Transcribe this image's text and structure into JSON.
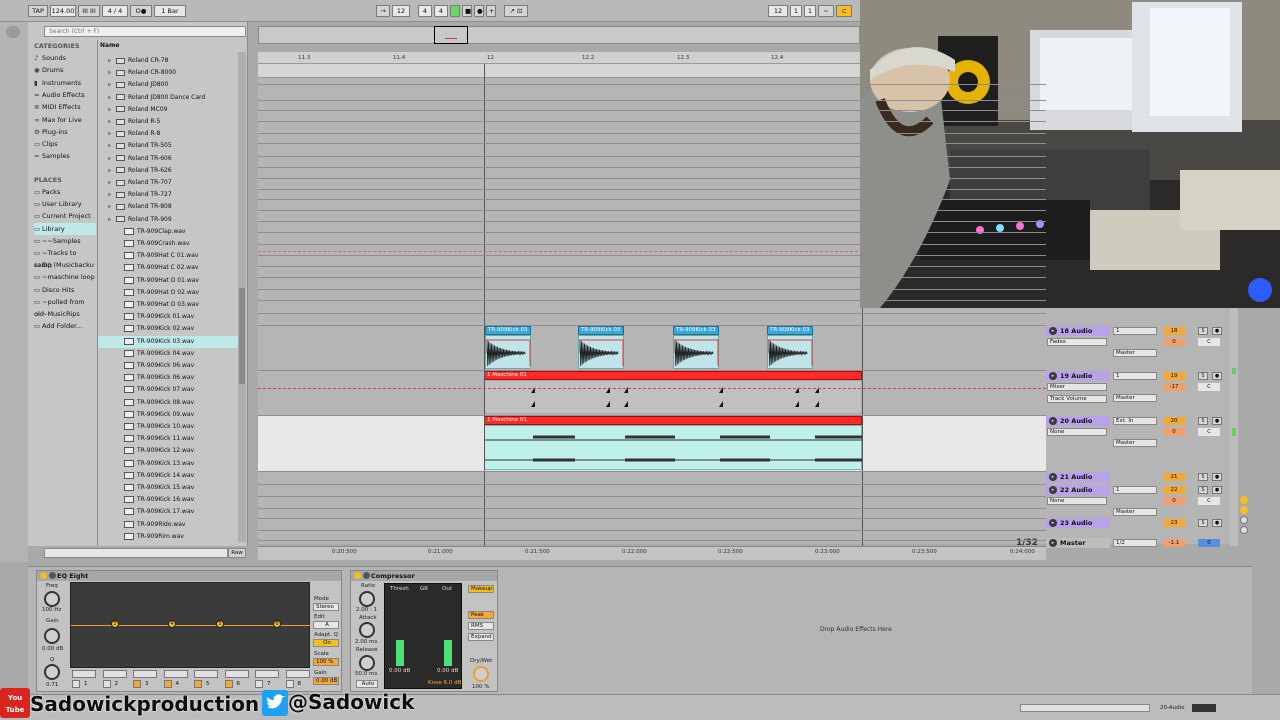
{
  "topbar": {
    "tap": "TAP",
    "tempo": "124.00",
    "sig": "4 / 4",
    "quant": "1 Bar",
    "pos_bar": "12",
    "pos_beat": "4",
    "pos_six": "4",
    "loop_bar": "12",
    "loop_beat": "1",
    "loop_six": "1"
  },
  "browser": {
    "search_placeholder": "Search (Ctrl + F)",
    "categories_title": "CATEGORIES",
    "categories": [
      "Sounds",
      "Drums",
      "Instruments",
      "Audio Effects",
      "MIDI Effects",
      "Max for Live",
      "Plug-ins",
      "Clips",
      "Samples"
    ],
    "places_title": "PLACES",
    "places": [
      "Packs",
      "User Library",
      "Current Project",
      "Library",
      "~~Samples",
      "~Tracks to samp",
      "D:\\ (Musicbacku",
      "~maschine loop",
      "Disco Hits",
      "~pulled from old",
      "~MusicRips",
      "Add Folder..."
    ],
    "name_header": "Name",
    "folders": [
      "Roland CR-78",
      "Roland CR-8000",
      "Roland JD800",
      "Roland JD800 Dance Card",
      "Roland MC09",
      "Roland R-5",
      "Roland R-8",
      "Roland TR-505",
      "Roland TR-606",
      "Roland TR-626",
      "Roland TR-707",
      "Roland TR-727",
      "Roland TR-808",
      "Roland TR-909"
    ],
    "files": [
      "TR-909Clap.wav",
      "TR-909Crash.wav",
      "TR-909Hat C 01.wav",
      "TR-909Hat C 02.wav",
      "TR-909Hat O 01.wav",
      "TR-909Hat O 02.wav",
      "TR-909Hat O 03.wav",
      "TR-909Kick 01.wav",
      "TR-909Kick 02.wav",
      "TR-909Kick 03.wav",
      "TR-909Kick 04.wav",
      "TR-909Kick 06.wav",
      "TR-909Kick 06.wav",
      "TR-909Kick 07.wav",
      "TR-909Kick 08.wav",
      "TR-909Kick 09.wav",
      "TR-909Kick 10.wav",
      "TR-909Kick 11.wav",
      "TR-909Kick 12.wav",
      "TR-909Kick 13.wav",
      "TR-909Kick 14.wav",
      "TR-909Kick 15.wav",
      "TR-909Kick 16.wav",
      "TR-909Kick 17.wav",
      "TR-909Rido.wav",
      "TR-909Rim.wav"
    ],
    "raw_label": "Raw"
  },
  "ruler": {
    "bars": [
      "11.3",
      "11.4",
      "12",
      "12.2",
      "12.3",
      "12.4"
    ]
  },
  "clips": {
    "kick": [
      "TR-909Kick 03",
      "TR-909Kick 03",
      "TR-909Kick 03",
      "TR-909Kick 03"
    ],
    "maschine1": "1 Maschine 01",
    "maschine2": "1 Maschine 01"
  },
  "tracks": [
    {
      "name": "18 Audio",
      "input": "Fades",
      "num": "18",
      "vol": "0",
      "pan": "C",
      "out": "Master"
    },
    {
      "name": "19 Audio",
      "input": "Mixer",
      "sub": "Track Volume",
      "num": "19",
      "vol": "-17",
      "pan": "C",
      "out": "Master"
    },
    {
      "name": "20 Audio",
      "input": "None",
      "in2": "Ext. In",
      "num": "20",
      "vol": "0",
      "pan": "C",
      "out": "Master"
    },
    {
      "name": "21 Audio",
      "num": "21"
    },
    {
      "name": "22 Audio",
      "input": "None",
      "num": "22",
      "vol": "0",
      "pan": "C",
      "out": "Master"
    },
    {
      "name": "23 Audio",
      "num": "23"
    },
    {
      "name": "Master",
      "sel": "1/2",
      "vol": "-1.1",
      "pan": "0"
    }
  ],
  "page_indicator": "1/32",
  "timeline": [
    "0:20:500",
    "0:21:000",
    "0:21:500",
    "0:22:000",
    "0:22:500",
    "0:23:000",
    "0:23:500",
    "0:24:000"
  ],
  "eq": {
    "title": "EQ Eight",
    "freq_label": "Freq",
    "freq_value": "100 Hz",
    "gain_label": "Gain",
    "gain_value": "0.00 dB",
    "q_label": "Q",
    "q_value": "0.71",
    "mode_label": "Mode",
    "mode_value": "Stereo",
    "edit_label": "Edit",
    "edit_value": "A",
    "adapt_label": "Adapt. Q",
    "adapt_value": "On",
    "scale_label": "Scale",
    "scale_value": "100 %",
    "gain_out_label": "Gain",
    "gain_out_value": "0.00 dB",
    "nodes": [
      "3",
      "4",
      "5",
      "6"
    ],
    "bands": [
      "1",
      "2",
      "3",
      "4",
      "5",
      "6",
      "7",
      "8"
    ]
  },
  "comp": {
    "title": "Compressor",
    "ratio_label": "Ratio",
    "ratio_value": "2.00 : 1",
    "attack_label": "Attack",
    "attack_value": "2.00 ms",
    "release_label": "Release",
    "release_value": "50.0 ms",
    "auto": "Auto",
    "thresh": "Thresh",
    "gr": "GR",
    "out": "Out",
    "thresh_value": "0.00 dB",
    "out_value": "0.00 dB",
    "knee": "Knee 6.0 dB",
    "makeup": "Makeup",
    "peak": "Peak",
    "rms": "RMS",
    "expand": "Expand",
    "drywet_label": "Dry/Wet",
    "drywet_value": "100 %"
  },
  "drop_text": "Drop Audio Effects Here",
  "status_track": "20-Audio",
  "overlay": {
    "youtube_text": "You Tube",
    "brand": "Sadowickproduction",
    "twitter": "@Sadowick"
  },
  "colors": {
    "clip_blue": "#3ea6d8",
    "clip_red": "#ff2a2a",
    "track_purple": "#b9a2ea",
    "orange": "#f3a83a"
  }
}
